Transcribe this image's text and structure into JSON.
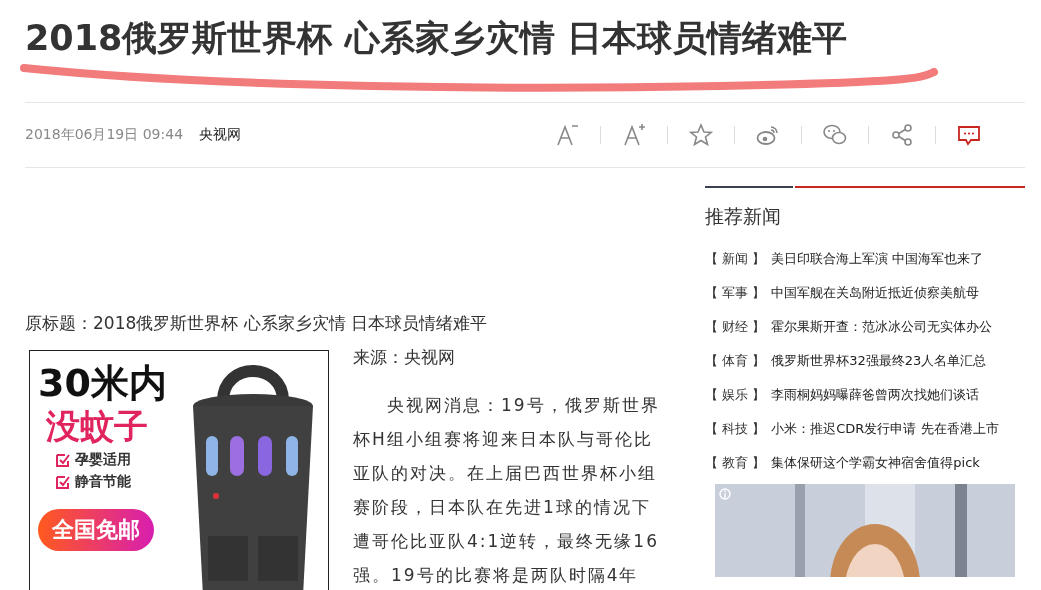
{
  "article": {
    "title": "2018俄罗斯世界杯 心系家乡灾情 日本球员情绪难平",
    "date": "2018年06月19日 09:44",
    "source": "央视网",
    "toolbar": [
      {
        "kind": "font-smaller"
      },
      {
        "kind": "font-larger"
      },
      {
        "kind": "favorite"
      },
      {
        "kind": "weibo"
      },
      {
        "kind": "wechat"
      },
      {
        "kind": "share"
      },
      {
        "kind": "comment"
      }
    ],
    "original_title": "原标题：2018俄罗斯世界杯 心系家乡灾情 日本球员情绪难平",
    "ad": {
      "headline": "30米内",
      "subline": "没蚊子",
      "features": [
        "孕婴适用",
        "静音节能"
      ],
      "badge": "全国免邮"
    },
    "source_line": "来源：央视网",
    "body": "央视网消息：19号，俄罗斯世界杯H组小组赛将迎来日本队与哥伦比亚队的对决。在上届巴西世界杯小组赛阶段，日本队在先进1球的情况下遭哥伦比亚队4:1逆转，最终无缘16强。19号的比赛将是两队时隔4年"
  },
  "sidebar": {
    "title": "推荐新闻",
    "items": [
      {
        "tag": "【 新闻 】",
        "headline": "美日印联合海上军演 中国海军也来了"
      },
      {
        "tag": "【 军事 】",
        "headline": "中国军舰在关岛附近抵近侦察美航母"
      },
      {
        "tag": "【 财经 】",
        "headline": "霍尔果斯开查：范冰冰公司无实体办公"
      },
      {
        "tag": "【 体育 】",
        "headline": "俄罗斯世界杯32强最终23人名单汇总"
      },
      {
        "tag": "【 娱乐 】",
        "headline": "李雨桐妈妈曝薛爸曾两次找她们谈话"
      },
      {
        "tag": "【 科技 】",
        "headline": "小米：推迟CDR发行申请 先在香港上市"
      },
      {
        "tag": "【 教育 】",
        "headline": "集体保研这个学霸女神宿舍值得pick"
      }
    ]
  }
}
